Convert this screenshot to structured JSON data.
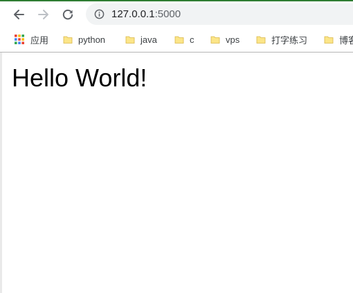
{
  "colors": {
    "toolbar_bg": "#ffffff",
    "omnibox_bg": "#f1f3f4",
    "folder_yellow": "#fbe588",
    "top_accent": "#2e7d32"
  },
  "toolbar": {
    "back_icon": "arrow-left",
    "forward_icon": "arrow-right",
    "reload_icon": "reload",
    "info_icon": "info-circle",
    "url_host": "127.0.0.1",
    "url_port": ":5000"
  },
  "bookmarks": [
    {
      "label": "应用",
      "icon": "apps-grid-icon"
    },
    {
      "label": "python",
      "icon": "folder-icon"
    },
    {
      "label": "java",
      "icon": "folder-icon"
    },
    {
      "label": "c",
      "icon": "folder-icon"
    },
    {
      "label": "vps",
      "icon": "folder-icon"
    },
    {
      "label": "打字练习",
      "icon": "folder-icon"
    },
    {
      "label": "博客",
      "icon": "folder-icon"
    }
  ],
  "page": {
    "heading": "Hello World!"
  }
}
